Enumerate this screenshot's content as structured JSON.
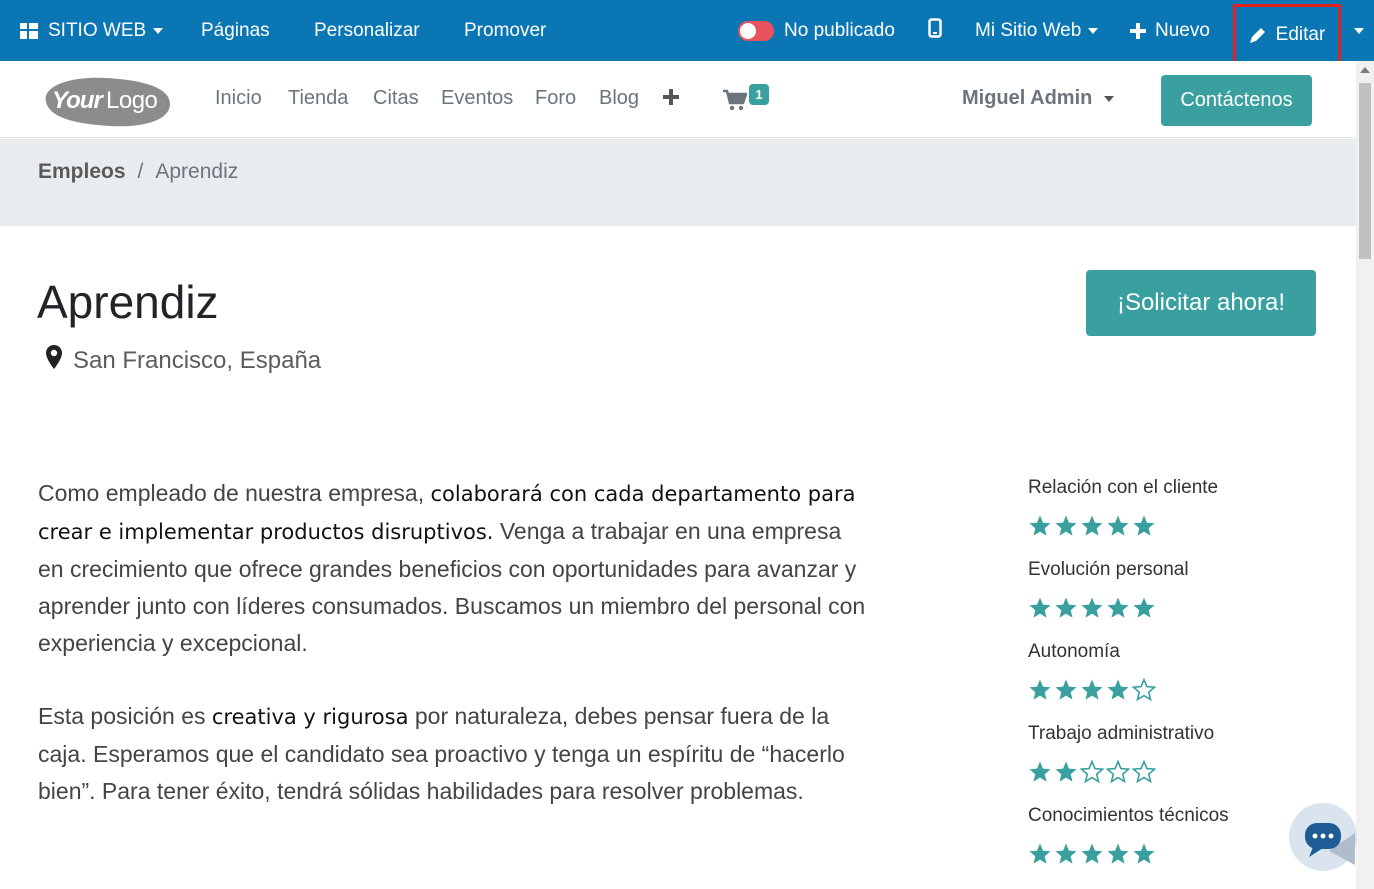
{
  "admin_bar": {
    "apps_label": "SITIO WEB",
    "pages": "Páginas",
    "customize": "Personalizar",
    "promote": "Promover",
    "publish_status": "No publicado",
    "website_selector": "Mi Sitio Web",
    "new": "Nuevo",
    "edit": "Editar"
  },
  "header": {
    "logo_text": "YourLogo",
    "nav": [
      "Inicio",
      "Tienda",
      "Citas",
      "Eventos",
      "Foro",
      "Blog"
    ],
    "cart_count": "1",
    "user": "Miguel Admin",
    "contact_button": "Contáctenos"
  },
  "breadcrumb": {
    "parent": "Empleos",
    "separator": "/",
    "current": "Aprendiz"
  },
  "job": {
    "title": "Aprendiz",
    "location": "San Francisco, España",
    "apply_button": "¡Solicitar ahora!",
    "paragraph1_start": "Como empleado de nuestra empresa, ",
    "paragraph1_bold": "colaborará con cada departamento para crear e implementar productos disruptivos.",
    "paragraph1_end": " Venga a trabajar en una empresa en crecimiento que ofrece grandes beneficios con oportunidades para avanzar y aprender junto con líderes consumados. Buscamos un miembro del personal con experiencia y excepcional.",
    "paragraph2_start": "Esta posición es ",
    "paragraph2_bold": "creativa y rigurosa",
    "paragraph2_end": " por naturaleza, debes pensar fuera de la caja. Esperamos que el candidato sea proactivo y tenga un espíritu de “hacerlo bien”. Para tener éxito, tendrá sólidas habilidades para resolver problemas."
  },
  "ratings": [
    {
      "label": "Relación con el cliente",
      "stars": 5,
      "max": 5
    },
    {
      "label": "Evolución personal",
      "stars": 5,
      "max": 5
    },
    {
      "label": "Autonomía",
      "stars": 4,
      "max": 5
    },
    {
      "label": "Trabajo administrativo",
      "stars": 2,
      "max": 5
    },
    {
      "label": "Conocimientos técnicos",
      "stars": 5,
      "max": 5
    }
  ],
  "colors": {
    "admin_bar": "#0b76b4",
    "accent": "#3a9f9f",
    "edit_highlight": "#e0211f",
    "toggle_off": "#e8535d"
  },
  "icons": [
    "apps-icon",
    "toggle-switch",
    "mobile-icon",
    "plus-icon",
    "pencil-icon",
    "cart-icon",
    "map-marker-icon",
    "star-icon",
    "chat-icon"
  ]
}
